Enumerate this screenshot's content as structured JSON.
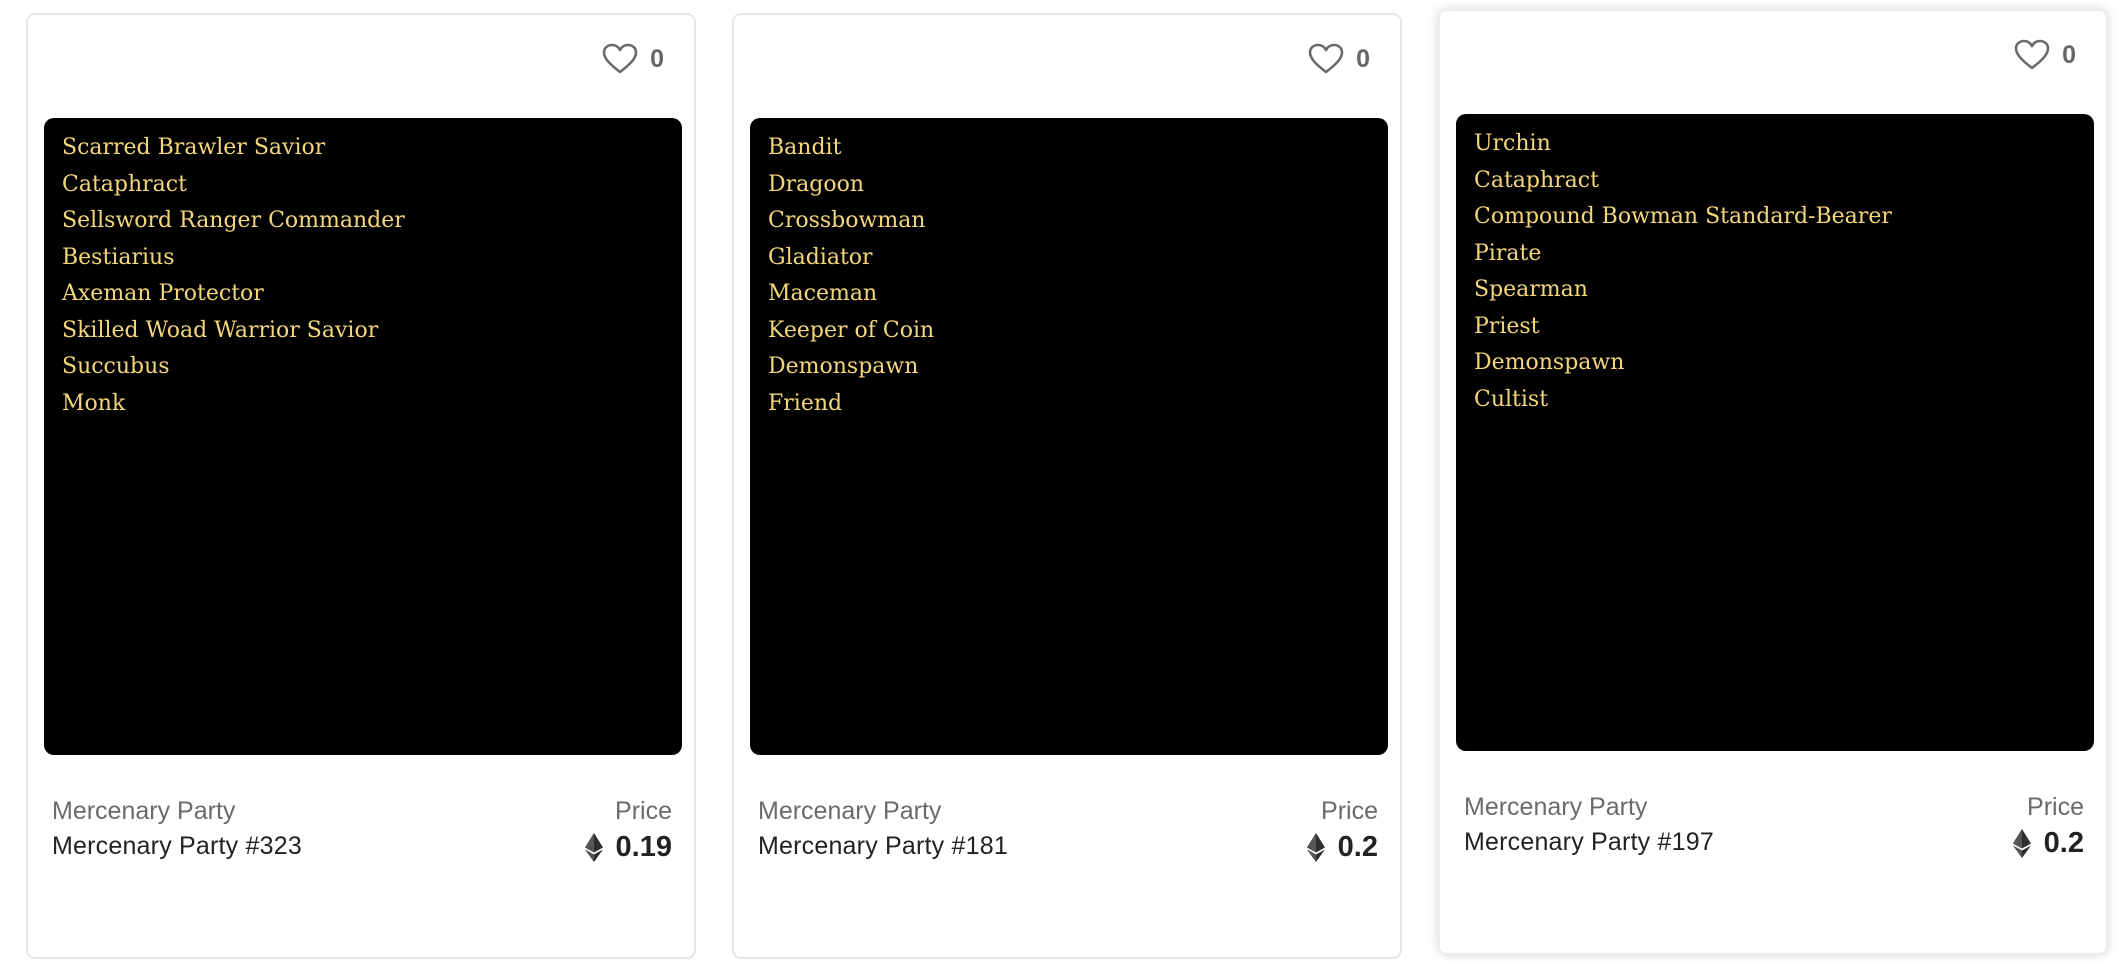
{
  "cards": [
    {
      "likes": "0",
      "units": [
        "Scarred Brawler Savior",
        "Cataphract",
        "Sellsword Ranger Commander",
        "Bestiarius",
        "Axeman Protector",
        "Skilled Woad Warrior Savior",
        "Succubus",
        "Monk"
      ],
      "collection": "Mercenary Party",
      "title": "Mercenary Party #323",
      "price_label": "Price",
      "price": "0.19",
      "currency_icon": "ethereum-icon"
    },
    {
      "likes": "0",
      "units": [
        "Bandit",
        "Dragoon",
        "Crossbowman",
        "Gladiator",
        "Maceman",
        "Keeper of Coin",
        "Demonspawn",
        "Friend"
      ],
      "collection": "Mercenary Party",
      "title": "Mercenary Party #181",
      "price_label": "Price",
      "price": "0.2",
      "currency_icon": "ethereum-icon"
    },
    {
      "likes": "0",
      "units": [
        "Urchin",
        "Cataphract",
        "Compound Bowman Standard-Bearer",
        "Pirate",
        "Spearman",
        "Priest",
        "Demonspawn",
        "Cultist"
      ],
      "collection": "Mercenary Party",
      "title": "Mercenary Party #197",
      "price_label": "Price",
      "price": "0.2",
      "currency_icon": "ethereum-icon"
    }
  ],
  "colors": {
    "unit_text": "#f5d77b",
    "art_background": "#000000",
    "card_border": "#e6e6e6"
  }
}
